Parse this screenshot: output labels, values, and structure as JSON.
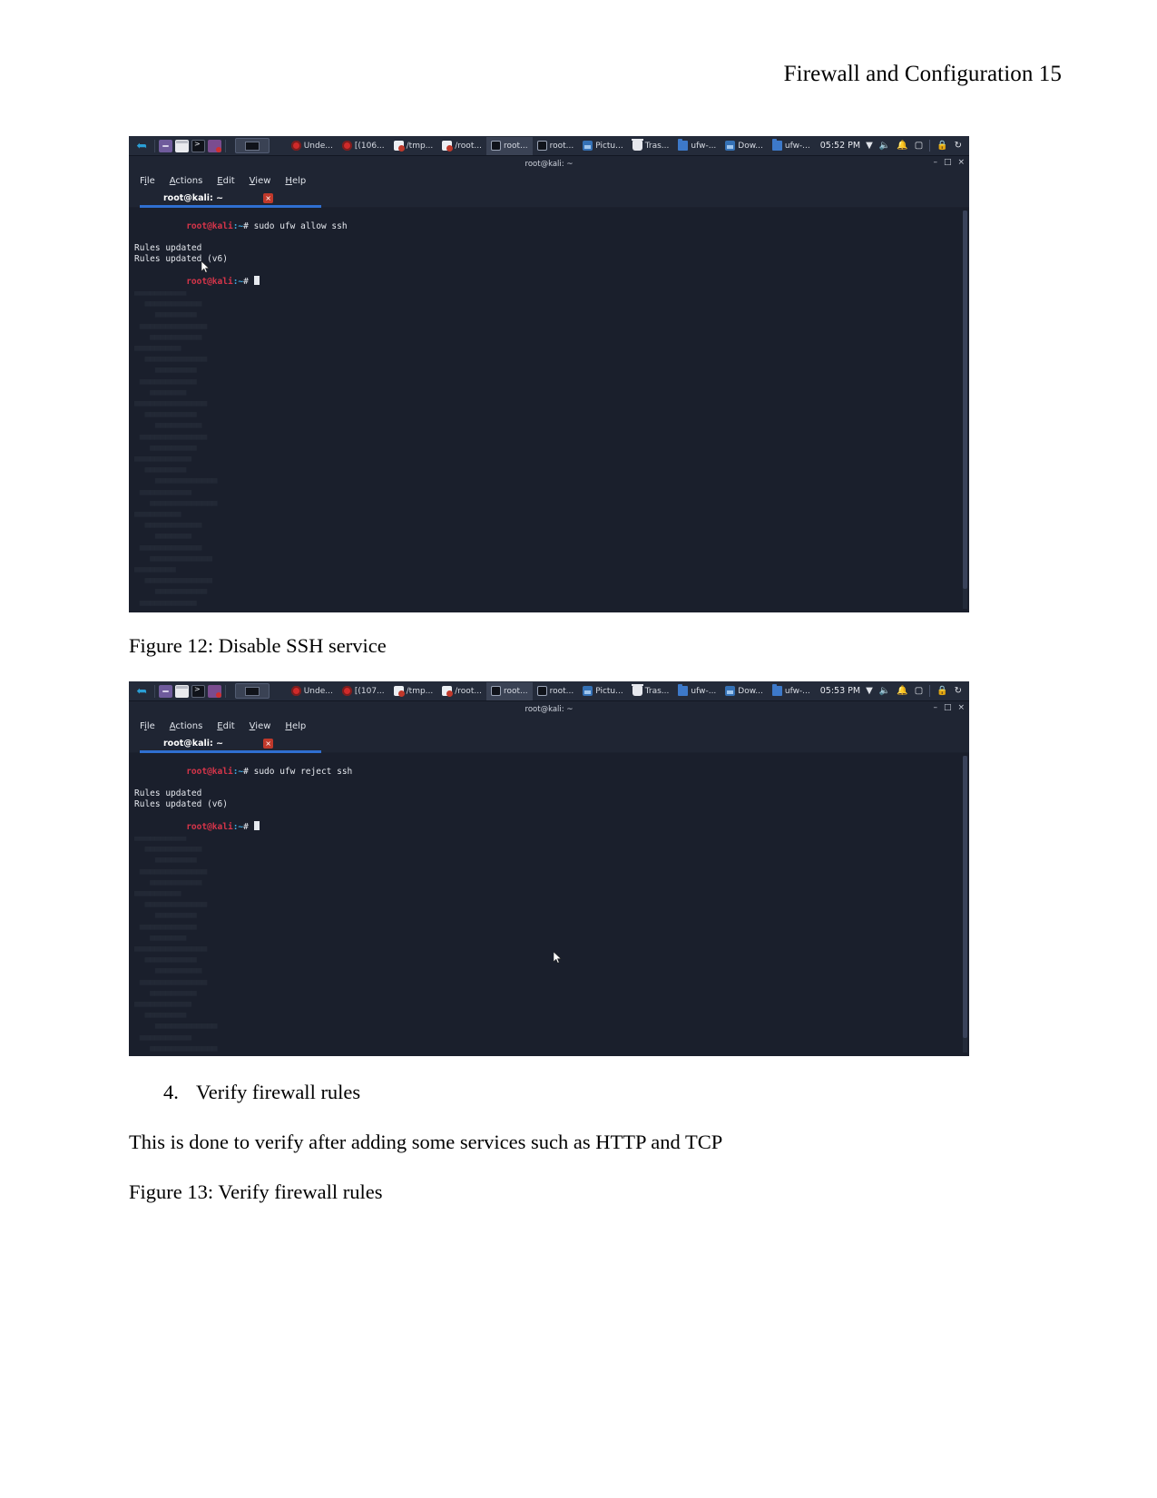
{
  "document": {
    "header": "Firewall and Configuration 15",
    "caption_fig12": "Figure 12: Disable SSH service",
    "caption_fig13": "Figure 13: Verify firewall rules",
    "list_item_number": "4.",
    "list_item_text": "Verify firewall rules",
    "paragraph": "This is done to verify after adding some services such as HTTP and TCP"
  },
  "figure12": {
    "taskbar": {
      "logo": "kali-dragon-icon",
      "launchers": [
        "terminal-emulator-icon",
        "file-manager-icon",
        "terminal-icon",
        "app-icon"
      ],
      "active_window_button": "active-window-thumbnail",
      "items": [
        {
          "icon": "opera-icon",
          "label": "Unde..."
        },
        {
          "icon": "opera-icon",
          "label": "[(106..."
        },
        {
          "icon": "pdf-icon",
          "label": "/tmp..."
        },
        {
          "icon": "pdf-icon",
          "label": "/root..."
        },
        {
          "icon": "terminal-icon",
          "label": "root...",
          "selected": true
        },
        {
          "icon": "terminal-icon",
          "label": "root..."
        },
        {
          "icon": "image-icon",
          "label": "Pictu..."
        },
        {
          "icon": "trash-icon",
          "label": "Tras..."
        },
        {
          "icon": "folder-icon",
          "label": "ufw-..."
        },
        {
          "icon": "image-icon",
          "label": "Dow..."
        },
        {
          "icon": "folder-icon",
          "label": "ufw-..."
        }
      ],
      "clock": "05:52 PM",
      "tray": [
        "network-icon",
        "volume-icon",
        "notification-bell-icon",
        "unknown-icon",
        "lock-icon",
        "power-icon"
      ]
    },
    "window": {
      "title": "root@kali: ~",
      "minimize": "–",
      "maximize": "□",
      "close": "×",
      "menu": [
        {
          "pre": "F",
          "key": "i",
          "post": "le"
        },
        {
          "pre": "",
          "key": "A",
          "post": "ctions"
        },
        {
          "pre": "",
          "key": "E",
          "post": "dit"
        },
        {
          "pre": "",
          "key": "V",
          "post": "iew"
        },
        {
          "pre": "",
          "key": "H",
          "post": "elp"
        }
      ],
      "tab_label": "root@kali: ~",
      "tab_close": "×"
    },
    "terminal": {
      "prompt_user": "root@kali",
      "prompt_path": ":~",
      "prompt_symbol": "# ",
      "command": "sudo ufw allow ssh",
      "output": [
        "Rules updated",
        "Rules updated (v6)"
      ]
    }
  },
  "figure13": {
    "taskbar": {
      "logo": "kali-dragon-icon",
      "launchers": [
        "terminal-emulator-icon",
        "file-manager-icon",
        "terminal-icon",
        "app-icon"
      ],
      "active_window_button": "active-window-thumbnail",
      "items": [
        {
          "icon": "opera-icon",
          "label": "Unde..."
        },
        {
          "icon": "opera-icon",
          "label": "[(107..."
        },
        {
          "icon": "pdf-icon",
          "label": "/tmp..."
        },
        {
          "icon": "pdf-icon",
          "label": "/root..."
        },
        {
          "icon": "terminal-icon",
          "label": "root...",
          "selected": true
        },
        {
          "icon": "terminal-icon",
          "label": "root..."
        },
        {
          "icon": "image-icon",
          "label": "Pictu..."
        },
        {
          "icon": "trash-icon",
          "label": "Tras..."
        },
        {
          "icon": "folder-icon",
          "label": "ufw-..."
        },
        {
          "icon": "image-icon",
          "label": "Dow..."
        },
        {
          "icon": "folder-icon",
          "label": "ufw-..."
        }
      ],
      "clock": "05:53 PM",
      "tray": [
        "network-icon",
        "volume-icon",
        "notification-bell-icon",
        "unknown-icon",
        "lock-icon",
        "power-icon"
      ]
    },
    "window": {
      "title": "root@kali: ~",
      "minimize": "–",
      "maximize": "□",
      "close": "×",
      "menu": [
        {
          "pre": "F",
          "key": "i",
          "post": "le"
        },
        {
          "pre": "",
          "key": "A",
          "post": "ctions"
        },
        {
          "pre": "",
          "key": "E",
          "post": "dit"
        },
        {
          "pre": "",
          "key": "V",
          "post": "iew"
        },
        {
          "pre": "",
          "key": "H",
          "post": "elp"
        }
      ],
      "tab_label": "root@kali: ~",
      "tab_close": "×"
    },
    "terminal": {
      "prompt_user": "root@kali",
      "prompt_path": ":~",
      "prompt_symbol": "# ",
      "command": "sudo ufw reject ssh",
      "output": [
        "Rules updated",
        "Rules updated (v6)"
      ]
    }
  }
}
